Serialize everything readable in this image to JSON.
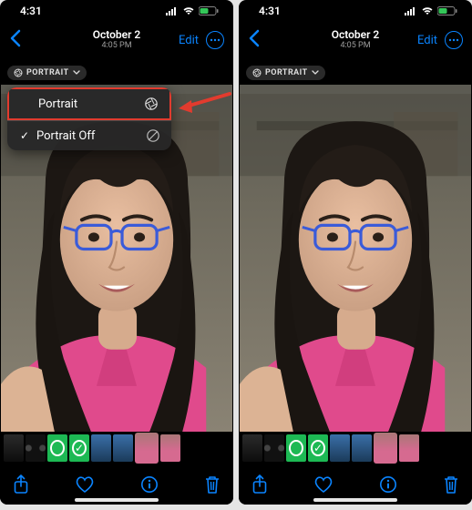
{
  "status": {
    "time": "4:31"
  },
  "nav": {
    "date": "October 2",
    "time": "4:05 PM",
    "edit_label": "Edit"
  },
  "badge": {
    "portrait_label": "PORTRAIT"
  },
  "menu": {
    "items": [
      {
        "label": "Portrait"
      },
      {
        "label": "Portrait Off"
      }
    ]
  },
  "colors": {
    "accent": "#0a84ff",
    "callout": "#e23b2e"
  }
}
